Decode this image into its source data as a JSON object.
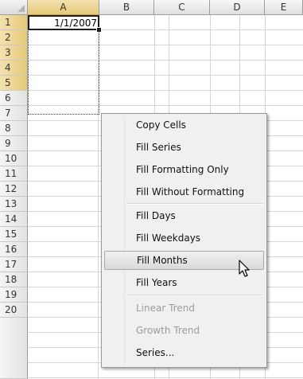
{
  "columns": [
    "A",
    "B",
    "C",
    "D",
    "E"
  ],
  "rows": [
    "1",
    "2",
    "3",
    "4",
    "5",
    "6",
    "7",
    "8",
    "9",
    "10",
    "11",
    "12",
    "13",
    "14",
    "15",
    "16",
    "17",
    "18",
    "19",
    "20"
  ],
  "cells": {
    "A1": "1/1/2007"
  },
  "context_menu": {
    "items": [
      {
        "label": "Copy Cells",
        "enabled": true
      },
      {
        "label": "Fill Series",
        "enabled": true
      },
      {
        "label": "Fill Formatting Only",
        "enabled": true
      },
      {
        "label": "Fill Without Formatting",
        "enabled": true
      },
      {
        "label": "Fill Days",
        "enabled": true
      },
      {
        "label": "Fill Weekdays",
        "enabled": true
      },
      {
        "label": "Fill Months",
        "enabled": true,
        "highlighted": true
      },
      {
        "label": "Fill Years",
        "enabled": true
      },
      {
        "label": "Linear Trend",
        "enabled": false
      },
      {
        "label": "Growth Trend",
        "enabled": false
      },
      {
        "label": "Series...",
        "enabled": true
      }
    ]
  },
  "colors": {
    "selection_header": "#e6c877",
    "gridline": "#d4d4d4",
    "disabled_text": "#9d9d9d"
  }
}
